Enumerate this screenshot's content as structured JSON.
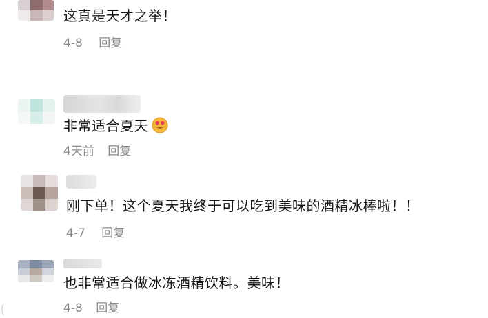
{
  "comments": [
    {
      "text": "这真是天才之举！",
      "date": "4-8",
      "reply_label": "回复"
    },
    {
      "text": "非常适合夏天",
      "emoji": "heart-eyes-emoji",
      "date": "4天前",
      "reply_label": "回复"
    },
    {
      "text": "刚下单！这个夏天我终于可以吃到美味的酒精冰棒啦！！",
      "date": "4-7",
      "reply_label": "回复"
    },
    {
      "text": "也非常适合做冰冻酒精饮料。美味！",
      "date": "4-8",
      "reply_label": "回复"
    }
  ]
}
